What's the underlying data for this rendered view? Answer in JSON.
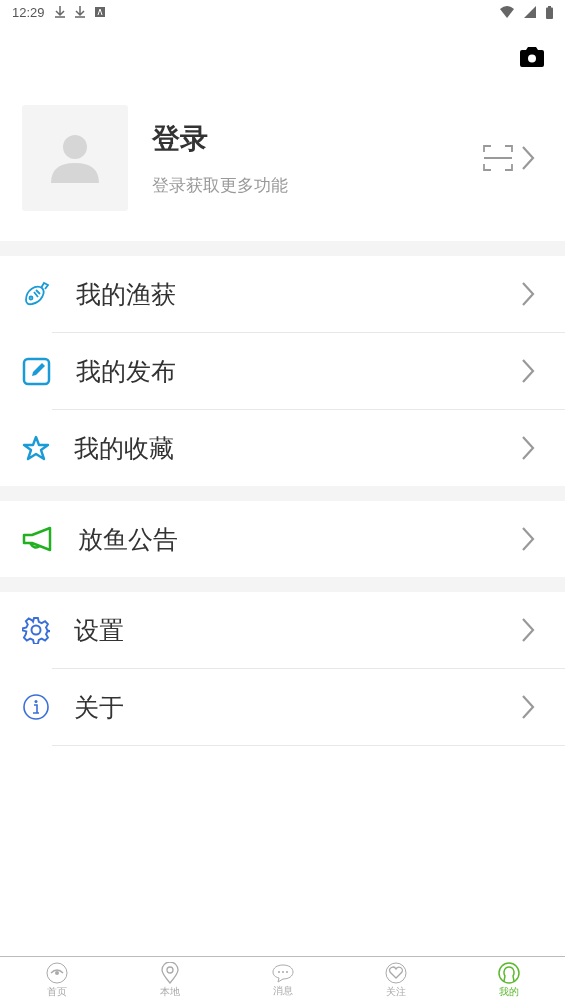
{
  "status_bar": {
    "time": "12:29"
  },
  "profile": {
    "name": "登录",
    "subtitle": "登录获取更多功能"
  },
  "groups": [
    {
      "items": [
        {
          "kind": "fish",
          "label": "我的渔获"
        },
        {
          "kind": "edit",
          "label": "我的发布"
        },
        {
          "kind": "star",
          "label": "我的收藏"
        }
      ]
    },
    {
      "items": [
        {
          "kind": "megaphone",
          "label": "放鱼公告"
        }
      ]
    },
    {
      "items": [
        {
          "kind": "gear",
          "label": "设置"
        },
        {
          "kind": "info",
          "label": "关于"
        }
      ]
    }
  ],
  "tab_bar": [
    {
      "kind": "home",
      "label": "首页",
      "selected": false
    },
    {
      "kind": "pin",
      "label": "本地",
      "selected": false
    },
    {
      "kind": "chat",
      "label": "消息",
      "selected": false
    },
    {
      "kind": "heart",
      "label": "关注",
      "selected": false
    },
    {
      "kind": "user",
      "label": "我的",
      "selected": true
    }
  ]
}
